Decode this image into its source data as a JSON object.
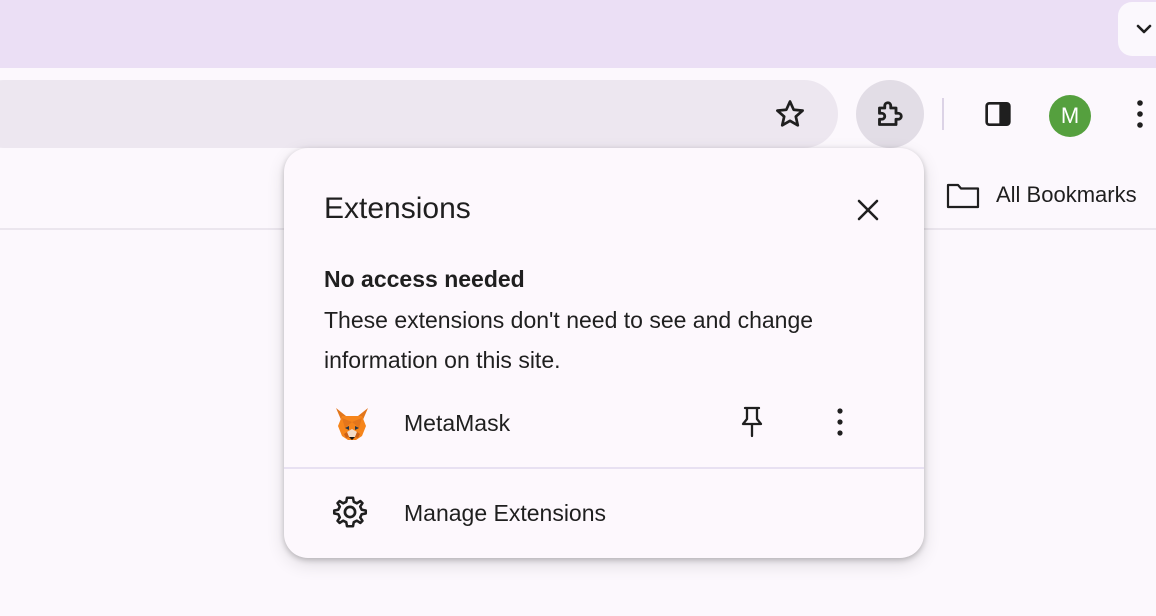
{
  "tabstrip": {
    "tab_search_icon": "chevron-down-icon"
  },
  "toolbar": {
    "bookmark_icon": "star-icon",
    "extensions_icon": "puzzle-icon",
    "side_panel_icon": "side-panel-icon",
    "profile_initial": "M",
    "profile_color": "#55a03e",
    "menu_icon": "vertical-dots-icon"
  },
  "bookmarks_bar": {
    "all_bookmarks_icon": "folder-icon",
    "all_bookmarks_label": "All Bookmarks"
  },
  "extensions_popup": {
    "title": "Extensions",
    "close_icon": "close-icon",
    "section_heading": "No access needed",
    "section_description": "These extensions don't need to see and change information on this site.",
    "extensions": [
      {
        "name": "MetaMask",
        "icon": "metamask-fox-icon",
        "pin_icon": "pin-icon",
        "more_icon": "vertical-dots-icon"
      }
    ],
    "manage_label": "Manage Extensions",
    "manage_icon": "gear-icon"
  },
  "colors": {
    "tabstrip_bg": "#ebdff5",
    "toolbar_bg": "#fcf8fd",
    "omnibox_bg": "#ede7f0",
    "popup_bg": "#fdf8fd",
    "text": "#1f1f1f"
  }
}
